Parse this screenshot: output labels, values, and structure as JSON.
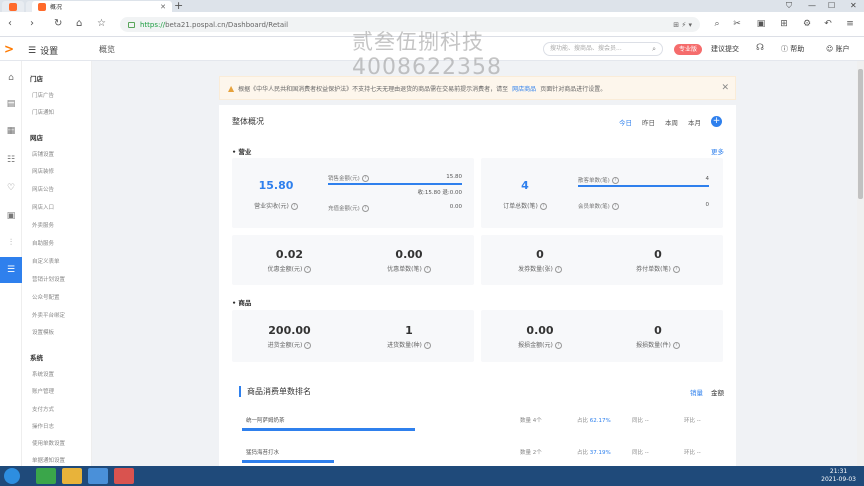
{
  "browser": {
    "tab_title": "概况",
    "url_https": "https://",
    "url_rest": "beta21.pospal.cn/Dashboard/Retail"
  },
  "header": {
    "menu_label": "设置",
    "breadcrumb": "概览",
    "search_placeholder": "搜功能、搜商品、搜会员...",
    "pro_badge": "专业版",
    "link_1": "建议提交",
    "help": "帮助",
    "account": "账户"
  },
  "watermark": {
    "line1": "贰叁伍捌科技",
    "line2": "4008622358"
  },
  "sidebar": {
    "groups": [
      {
        "title": "门店",
        "items": [
          "门店广告",
          "门店通知"
        ]
      },
      {
        "title": "网店",
        "items": [
          "店铺设置",
          "网店装修",
          "网店公告",
          "网店入口",
          "外卖服务",
          "自助服务",
          "自定义表单",
          "营销计划设置",
          "公众号配置",
          "外卖平台绑定",
          "设置模板"
        ]
      },
      {
        "title": "系统",
        "items": [
          "系统设置",
          "账户管理",
          "支付方式",
          "操作日志",
          "使用单数设置",
          "单据通知设置"
        ]
      }
    ]
  },
  "notice": {
    "text": "根据《中华人民共和国消费者权益保护法》不支持七天无理由退货的商品需在交易前提示消费者，请至",
    "link": "网店商品",
    "suffix": "页面针对商品进行设置。"
  },
  "overview": {
    "title": "整体概况",
    "periods": [
      "今日",
      "昨日",
      "本周",
      "本月"
    ],
    "business": {
      "section": "营业",
      "more": "更多",
      "income_value": "15.80",
      "income_label": "营业实收(元)",
      "sales_label": "销售金额(元)",
      "sales_value": "15.80",
      "sales_detail": "收:15.80 退:0.00",
      "sales_fill": 1.0,
      "recharge_label": "充值金额(元)",
      "recharge_value": "0.00",
      "orders_value": "4",
      "orders_label": "订单总数(笔)",
      "guest_label": "散客单数(笔)",
      "guest_value": "4",
      "guest_fill": 1.0,
      "member_label": "会员单数(笔)",
      "member_value": "0"
    },
    "discount": {
      "discount_value": "0.02",
      "discount_label": "优惠金额(元)",
      "discount_count_value": "0.00",
      "discount_count_label": "优惠单数(笔)",
      "coupon_value": "0",
      "coupon_label": "发券数量(张)",
      "coupon_used_value": "0",
      "coupon_used_label": "券付单数(笔)"
    },
    "goods": {
      "section": "商品",
      "stockin_amount_value": "200.00",
      "stockin_amount_label": "进货金额(元)",
      "stockin_qty_value": "1",
      "stockin_qty_label": "进货数量(种)",
      "loss_amount_value": "0.00",
      "loss_amount_label": "报损金额(元)",
      "loss_qty_value": "0",
      "loss_qty_label": "报损数量(件)"
    }
  },
  "ranking": {
    "title": "商品消费单数排名",
    "tabs": [
      "销量",
      "金额"
    ],
    "rows": [
      {
        "name": "统一阿萨姆奶茶",
        "qty": "数量 4个",
        "share_label": "占比",
        "share": "62.17%",
        "col1": "同比 --",
        "col2": "环比 --",
        "fill": 0.62
      },
      {
        "name": "猛犸海苔打水",
        "qty": "数量 2个",
        "share_label": "占比",
        "share": "37.19%",
        "col1": "同比 --",
        "col2": "环比 --",
        "fill": 0.33
      }
    ]
  },
  "taskbar": {
    "time": "21:31",
    "date": "2021-09-03"
  }
}
